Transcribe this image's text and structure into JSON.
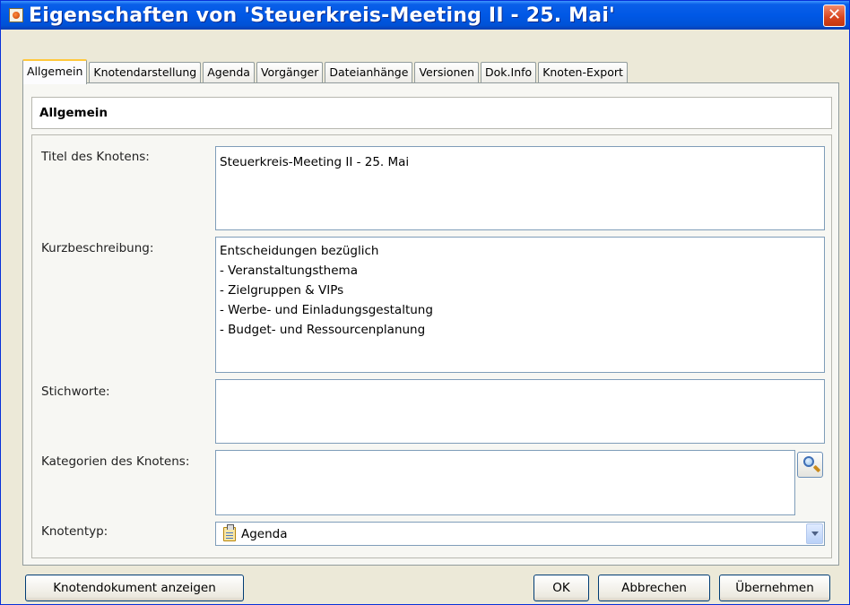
{
  "window": {
    "title": "Eigenschaften von 'Steuerkreis-Meeting II - 25. Mai'",
    "close_glyph": "✕"
  },
  "tabs": [
    {
      "label": "Allgemein",
      "active": true
    },
    {
      "label": "Knotendarstellung",
      "active": false
    },
    {
      "label": "Agenda",
      "active": false
    },
    {
      "label": "Vorgänger",
      "active": false
    },
    {
      "label": "Dateianhänge",
      "active": false
    },
    {
      "label": "Versionen",
      "active": false
    },
    {
      "label": "Dok.Info",
      "active": false
    },
    {
      "label": "Knoten-Export",
      "active": false
    }
  ],
  "section": {
    "title": "Allgemein"
  },
  "form": {
    "title_label": "Titel des Knotens:",
    "title_value": "Steuerkreis-Meeting II - 25. Mai",
    "summary_label": "Kurzbeschreibung:",
    "summary_value": "Entscheidungen bezüglich\n- Veranstaltungsthema\n- Zielgruppen & VIPs\n- Werbe- und Einladungsgestaltung\n- Budget- und Ressourcenplanung",
    "keywords_label": "Stichworte:",
    "keywords_value": "",
    "categories_label": "Kategorien des Knotens:",
    "categories_value": "",
    "nodetype_label": "Knotentyp:",
    "nodetype_value": "Agenda"
  },
  "icons": {
    "window": "java-app-icon",
    "close": "close-icon",
    "search": "search-icon",
    "nodetype": "clipboard-icon",
    "dropdown": "chevron-down-icon"
  },
  "buttons": {
    "show_document": "Knotendokument anzeigen",
    "ok": "OK",
    "cancel": "Abbrechen",
    "apply": "Übernehmen"
  },
  "colors": {
    "titlebar": "#0058e6",
    "active_tab_accent": "#ffc83c",
    "close_button": "#d7451f"
  }
}
